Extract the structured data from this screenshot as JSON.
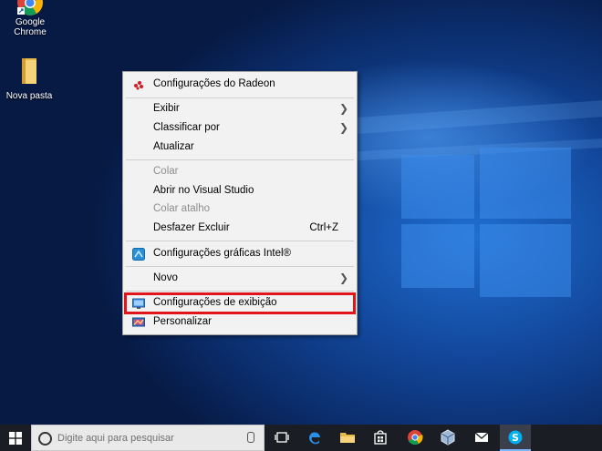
{
  "desktop": {
    "icons": [
      {
        "label": "Google Chrome",
        "icon": "chrome-shortcut-icon"
      },
      {
        "label": "Nova pasta",
        "icon": "folder-icon"
      }
    ]
  },
  "context_menu": {
    "items": [
      {
        "label": "Configurações do Radeon",
        "icon": "radeon-icon"
      },
      {
        "label": "Exibir",
        "submenu": true
      },
      {
        "label": "Classificar por",
        "submenu": true
      },
      {
        "label": "Atualizar"
      },
      {
        "label": "Colar",
        "disabled": true
      },
      {
        "label": "Abrir no Visual Studio"
      },
      {
        "label": "Colar atalho",
        "disabled": true
      },
      {
        "label": "Desfazer Excluir",
        "shortcut": "Ctrl+Z"
      },
      {
        "label": "Configurações gráficas Intel®",
        "icon": "intel-graphics-icon"
      },
      {
        "label": "Novo",
        "submenu": true
      },
      {
        "label": "Configurações de exibição",
        "icon": "display-settings-icon",
        "highlighted": true
      },
      {
        "label": "Personalizar",
        "icon": "personalize-icon"
      }
    ],
    "highlight_color": "#e0141a"
  },
  "taskbar": {
    "search_placeholder": "Digite aqui para pesquisar",
    "pinned_icons": [
      "task-view-icon",
      "edge-icon",
      "file-explorer-icon",
      "store-icon",
      "chrome-icon",
      "virtualbox-icon",
      "mail-icon",
      "skype-icon"
    ],
    "active": "skype-icon"
  }
}
